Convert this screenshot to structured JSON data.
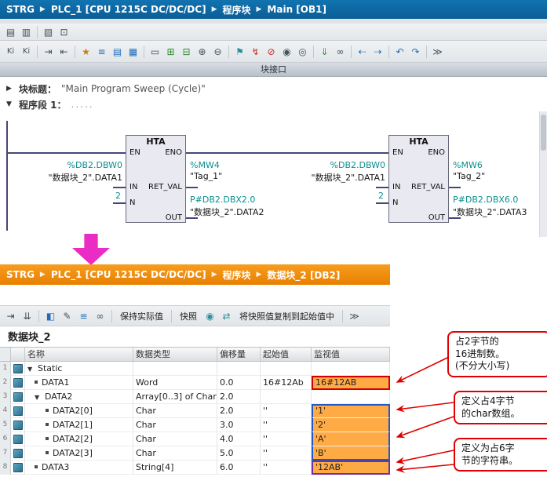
{
  "ui": {
    "crumb_sep": "▶",
    "caret_down": "▼",
    "caret_right": "▶"
  },
  "top": {
    "breadcrumb": [
      "STRG",
      "PLC_1 [CPU 1215C DC/DC/DC]",
      "程序块",
      "Main [OB1]"
    ],
    "toolbar_a": [
      {
        "name": "new-object-icon",
        "glyph": "▤"
      },
      {
        "name": "open-object-icon",
        "glyph": "▥"
      },
      {
        "name": "library-icon",
        "glyph": "▧"
      },
      {
        "name": "detail-view-icon",
        "glyph": "⊡"
      }
    ],
    "toolbar_b": [
      {
        "name": "operand-absolute-icon",
        "glyph": "Ki"
      },
      {
        "name": "operand-symbolic-icon",
        "glyph": "Ki"
      },
      {
        "name": "insert-row-icon",
        "glyph": "⇥"
      },
      {
        "name": "delete-row-icon",
        "glyph": "⇤"
      },
      {
        "name": "favorites-icon",
        "glyph": "★"
      },
      {
        "name": "network-list-icon",
        "glyph": "≡"
      },
      {
        "name": "insert-network-icon",
        "glyph": "▤"
      },
      {
        "name": "insert-empty-box-icon",
        "glyph": "▦"
      },
      {
        "name": "comment-toggle-icon",
        "glyph": "▭"
      },
      {
        "name": "open-branch-icon",
        "glyph": "⊞"
      },
      {
        "name": "close-branch-icon",
        "glyph": "⊟"
      },
      {
        "name": "insert-input-icon",
        "glyph": "⊕"
      },
      {
        "name": "remove-input-icon",
        "glyph": "⊖"
      },
      {
        "name": "jump-label-icon",
        "glyph": "⚑"
      },
      {
        "name": "clear-setpoints-icon",
        "glyph": "↯"
      },
      {
        "name": "stop-monitoring-icon",
        "glyph": "⊘"
      },
      {
        "name": "coil-icon",
        "glyph": "◉"
      },
      {
        "name": "contact-icon",
        "glyph": "◎"
      },
      {
        "name": "download-icon",
        "glyph": "⇓"
      },
      {
        "name": "monitoring-glasses-icon",
        "glyph": "∞"
      },
      {
        "name": "prev-error-icon",
        "glyph": "⇠"
      },
      {
        "name": "next-error-icon",
        "glyph": "⇢"
      },
      {
        "name": "prev-usage-icon",
        "glyph": "↶"
      },
      {
        "name": "next-usage-icon",
        "glyph": "↷"
      },
      {
        "name": "expand-all-icon",
        "glyph": "≫"
      }
    ],
    "interface_bar": "块接口",
    "block_title": {
      "label": "块标题：",
      "value": "\"Main Program Sweep (Cycle)\""
    },
    "network": {
      "label": "程序段 1：",
      "comment": "....."
    },
    "ladder": {
      "blocks": [
        {
          "title": "HTA",
          "en": "EN",
          "eno": "ENO",
          "in_pin": "IN",
          "n_pin": "N",
          "ret_pin": "RET_VAL",
          "out_pin": "OUT",
          "in_addr": "%DB2.DBW0",
          "in_name": "\"数据块_2\".DATA1",
          "n_val": "2",
          "ret_addr": "%MW4",
          "ret_name": "\"Tag_1\"",
          "out_addr": "P#DB2.DBX2.0",
          "out_name": "\"数据块_2\".DATA2"
        },
        {
          "title": "HTA",
          "en": "EN",
          "eno": "ENO",
          "in_pin": "IN",
          "n_pin": "N",
          "ret_pin": "RET_VAL",
          "out_pin": "OUT",
          "in_addr": "%DB2.DBW0",
          "in_name": "\"数据块_2\".DATA1",
          "n_val": "2",
          "ret_addr": "%MW6",
          "ret_name": "\"Tag_2\"",
          "out_addr": "P#DB2.DBX6.0",
          "out_name": "\"数据块_2\".DATA3"
        }
      ]
    }
  },
  "bottom": {
    "breadcrumb": [
      "STRG",
      "PLC_1 [CPU 1215C DC/DC/DC]",
      "程序块",
      "数据块_2 [DB2]"
    ],
    "toolbar": {
      "icons": [
        {
          "name": "insert-row-icon",
          "glyph": "⇥"
        },
        {
          "name": "add-row-icon",
          "glyph": "⇊"
        },
        {
          "name": "load-start-values-icon",
          "glyph": "◧"
        },
        {
          "name": "edit-icon",
          "glyph": "✎"
        },
        {
          "name": "list-icon",
          "glyph": "≡"
        },
        {
          "name": "monitor-all-glasses-icon",
          "glyph": "∞"
        },
        {
          "name": "snapshot-camera-icon",
          "glyph": "◉"
        },
        {
          "name": "snapshot-transfer-icon",
          "glyph": "⇄"
        },
        {
          "name": "expand-all-icon",
          "glyph": "≫"
        }
      ],
      "keep_values": "保持实际值",
      "snapshot": "快照",
      "copy_snapshot": "将快照值复制到起始值中"
    },
    "title": "数据块_2",
    "table": {
      "headers": {
        "name": "名称",
        "type": "数据类型",
        "offset": "偏移量",
        "start": "起始值",
        "monitor": "监视值"
      },
      "rows": [
        {
          "num": "1",
          "name": "Static",
          "type": "",
          "offset": "",
          "start": "",
          "monitor": ""
        },
        {
          "num": "2",
          "name": "DATA1",
          "type": "Word",
          "offset": "0.0",
          "start": "16#12Ab",
          "monitor": "16#12AB"
        },
        {
          "num": "3",
          "name": "DATA2",
          "type": "Array[0..3] of Char",
          "offset": "2.0",
          "start": "",
          "monitor": ""
        },
        {
          "num": "4",
          "name": "DATA2[0]",
          "type": "Char",
          "offset": "2.0",
          "start": "''",
          "monitor": "'1'"
        },
        {
          "num": "5",
          "name": "DATA2[1]",
          "type": "Char",
          "offset": "3.0",
          "start": "''",
          "monitor": "'2'"
        },
        {
          "num": "6",
          "name": "DATA2[2]",
          "type": "Char",
          "offset": "4.0",
          "start": "''",
          "monitor": "'A'"
        },
        {
          "num": "7",
          "name": "DATA2[3]",
          "type": "Char",
          "offset": "5.0",
          "start": "''",
          "monitor": "'B'"
        },
        {
          "num": "8",
          "name": "DATA3",
          "type": "String[4]",
          "offset": "6.0",
          "start": "''",
          "monitor": "'12AB'"
        }
      ]
    },
    "callouts": [
      {
        "text": "占2字节的\n16进制数。\n(不分大小写)"
      },
      {
        "text": "定义占4字节\n的char数组。"
      },
      {
        "text": "定义为占6字\n节的字符串。"
      }
    ]
  },
  "colors": {
    "highlight_orange": "#ffab45",
    "border_red": "#d40000",
    "border_blue": "#2456c8",
    "border_purple": "#7030a0",
    "arrow_magenta": "#ea2cc5"
  }
}
